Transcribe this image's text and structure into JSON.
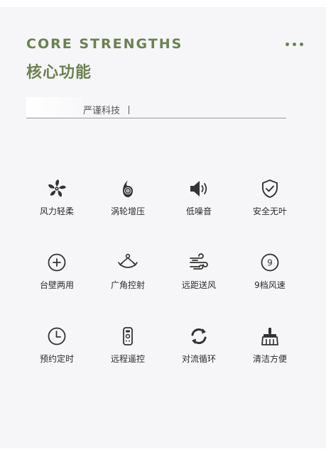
{
  "header": {
    "eyebrow": "CORE STRENGTHS",
    "title": "核心功能",
    "tagline": "严谨科技",
    "more_icon": "more-dots-icon",
    "accent_color": "#6b8150"
  },
  "features": [
    {
      "label": "风力轻柔",
      "icon": "fan-icon"
    },
    {
      "label": "涡轮增压",
      "icon": "turbo-icon"
    },
    {
      "label": "低噪音",
      "icon": "speaker-icon"
    },
    {
      "label": "安全无叶",
      "icon": "shield-check-icon"
    },
    {
      "label": "台壁两用",
      "icon": "plus-circle-icon"
    },
    {
      "label": "广角控射",
      "icon": "wide-angle-icon"
    },
    {
      "label": "远距送风",
      "icon": "wind-icon"
    },
    {
      "label": "9档风速",
      "icon": "speed-nine-icon",
      "badge": "9"
    },
    {
      "label": "预约定时",
      "icon": "clock-icon"
    },
    {
      "label": "远程遥控",
      "icon": "remote-icon"
    },
    {
      "label": "对流循环",
      "icon": "refresh-icon"
    },
    {
      "label": "清洁方便",
      "icon": "brush-icon"
    }
  ]
}
